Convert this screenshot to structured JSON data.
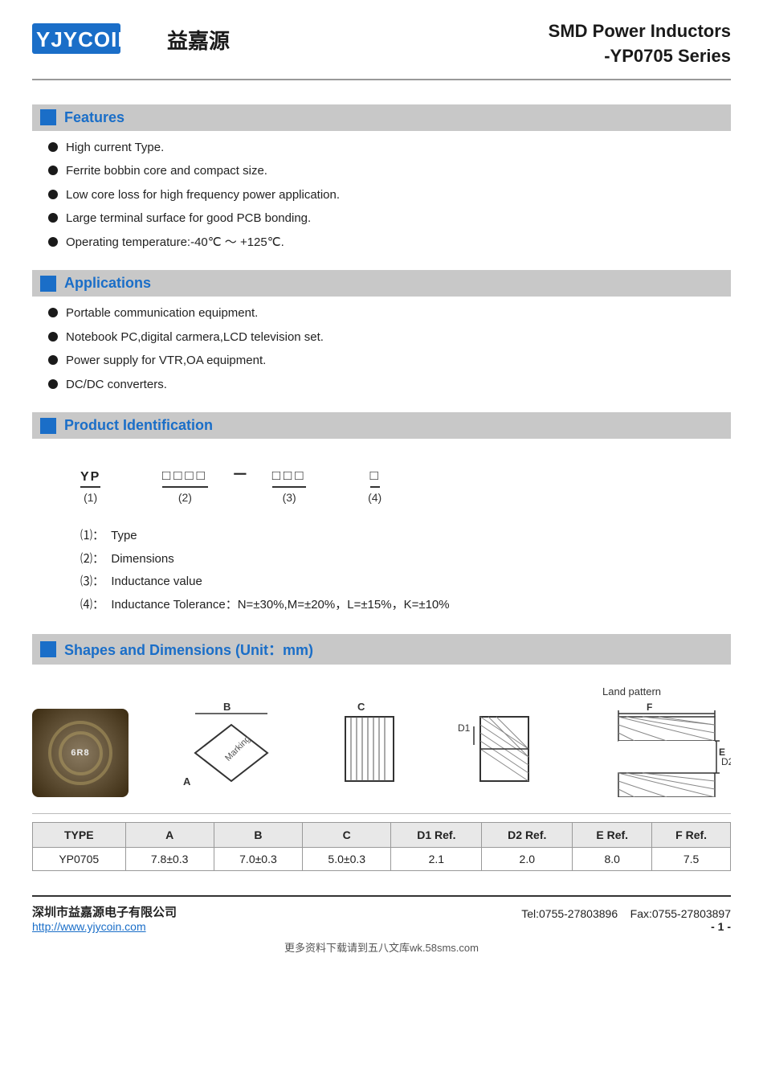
{
  "header": {
    "logo_text": "YJYCOIN",
    "logo_chinese": "益嘉源",
    "main_title": "SMD Power Inductors",
    "sub_title": "-YP0705 Series"
  },
  "features": {
    "section_label": "Features",
    "items": [
      "High current Type.",
      "Ferrite bobbin core and compact size.",
      "Low core loss for high frequency power application.",
      "Large terminal surface for good PCB bonding.",
      "Operating temperature:-40℃ ～ +125℃."
    ]
  },
  "applications": {
    "section_label": "Applications",
    "items": [
      "Portable communication equipment.",
      "Notebook PC,digital carmera,LCD television set.",
      "Power supply for VTR,OA equipment.",
      "DC/DC converters."
    ]
  },
  "product_id": {
    "section_label": "Product Identification",
    "parts": [
      {
        "code": "YP",
        "label": "(1)"
      },
      {
        "code": "□□□□",
        "label": "(2)"
      },
      {
        "code": "□□□",
        "label": "(3)"
      },
      {
        "code": "□",
        "label": "(4)"
      }
    ],
    "dash": "－",
    "notes": [
      {
        "num": "⑴",
        "sep": "：",
        "text": "Type"
      },
      {
        "num": "⑵",
        "sep": "：",
        "text": "Dimensions"
      },
      {
        "num": "⑶",
        "sep": "：",
        "text": "Inductance value"
      },
      {
        "num": "⑷",
        "sep": "：",
        "text": "Inductance Tolerance：N=±30%,M=±20%，L=±15%，K=±10%"
      }
    ]
  },
  "shapes": {
    "section_label": "Shapes and Dimensions (Unit：mm)",
    "land_pattern_label": "Land pattern",
    "table": {
      "headers": [
        "TYPE",
        "A",
        "B",
        "C",
        "D1 Ref.",
        "D2 Ref.",
        "E Ref.",
        "F Ref."
      ],
      "rows": [
        [
          "YP0705",
          "7.8±0.3",
          "7.0±0.3",
          "5.0±0.3",
          "2.1",
          "2.0",
          "8.0",
          "7.5"
        ]
      ]
    }
  },
  "footer": {
    "company": "深圳市益嘉源电子有限公司",
    "website": "http://www.yjycoin.com",
    "tel": "Tel:0755-27803896",
    "fax": "Fax:0755-27803897",
    "page": "- 1 -",
    "bottom_text": "更多资料下载请到五八文库wk.58sms.com"
  }
}
